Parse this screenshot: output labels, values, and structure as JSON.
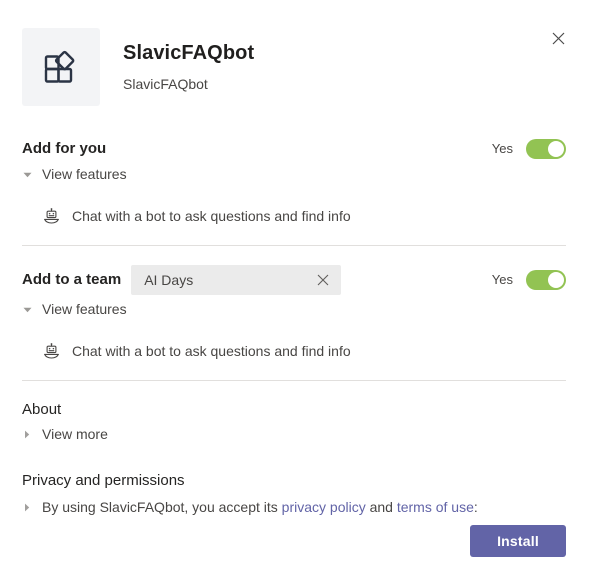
{
  "dialog": {
    "close_icon": "close-icon",
    "app": {
      "icon": "app-grid-diamond-icon",
      "title": "SlavicFAQbot",
      "publisher": "SlavicFAQbot"
    },
    "sections": [
      {
        "id": "add-for-you",
        "title": "Add for you",
        "toggle": {
          "label": "Yes",
          "on": true,
          "color": "#92c353"
        },
        "disclosure": {
          "label": "View features",
          "expanded": true,
          "icon": "triangle-down-icon"
        },
        "features": [
          {
            "icon": "bot-icon",
            "text": "Chat with a bot to ask questions and find info"
          }
        ]
      },
      {
        "id": "add-to-a-team",
        "title": "Add to a team",
        "team_picker": {
          "value": "AI Days",
          "placeholder": "Type a team name",
          "clear_icon": "close-icon"
        },
        "toggle": {
          "label": "Yes",
          "on": true,
          "color": "#92c353"
        },
        "disclosure": {
          "label": "View features",
          "expanded": true,
          "icon": "triangle-down-icon"
        },
        "features": [
          {
            "icon": "bot-icon",
            "text": "Chat with a bot to ask questions and find info"
          }
        ]
      }
    ],
    "about": {
      "title": "About",
      "disclosure": {
        "label": "View more",
        "expanded": false,
        "icon": "triangle-right-icon"
      }
    },
    "privacy": {
      "title": "Privacy and permissions",
      "disclosure_icon": "triangle-right-icon",
      "text_before": "By using SlavicFAQbot, you accept its ",
      "link_privacy": "privacy policy",
      "text_middle": " and ",
      "link_terms": "terms of use",
      "text_after": ":",
      "link_color": "#6264a7"
    },
    "footer": {
      "install_label": "Install",
      "install_color": "#6264a7"
    }
  }
}
